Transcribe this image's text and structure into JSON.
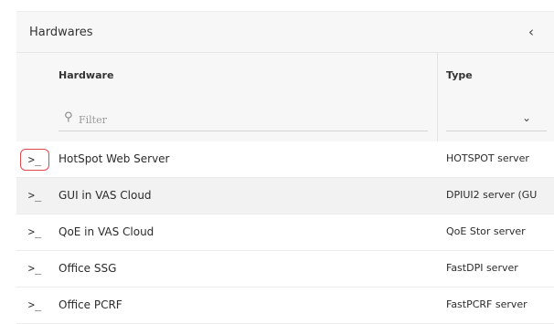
{
  "panel": {
    "title": "Hardwares",
    "collapse_icon": "chevron-left-icon"
  },
  "table": {
    "columns": [
      "Hardware",
      "Type"
    ],
    "filter_placeholder": "Filter",
    "rows": [
      {
        "hardware": "HotSpot Web Server",
        "type": "HOTSPOT server"
      },
      {
        "hardware": "GUI in VAS Cloud",
        "type": "DPIUI2 server (GU"
      },
      {
        "hardware": "QoE in VAS Cloud",
        "type": "QoE Stor server"
      },
      {
        "hardware": "Office SSG",
        "type": "FastDPI server"
      },
      {
        "hardware": "Office PCRF",
        "type": "FastPCRF server"
      }
    ],
    "row_action_symbol": ">_",
    "focus_color": "#e0484b"
  }
}
